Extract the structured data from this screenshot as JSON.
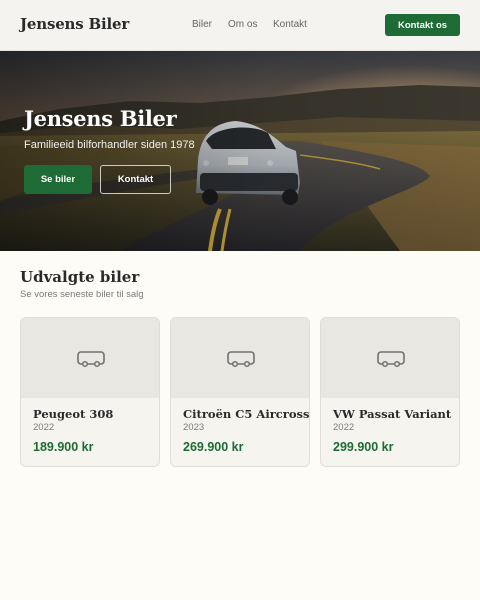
{
  "header": {
    "logo": "Jensens Biler",
    "nav": [
      "Biler",
      "Om os",
      "Kontakt"
    ],
    "cta_label": "Kontakt os"
  },
  "hero": {
    "title": "Jensens Biler",
    "subtitle": "Familieeid bilforhandler siden 1978",
    "primary_button": "Se biler",
    "secondary_button": "Kontakt"
  },
  "featured": {
    "title": "Udvalgte biler",
    "subtitle": "Se vores seneste biler til salg",
    "cars": [
      {
        "name": "Peugeot 308",
        "year": "2022",
        "price": "189.900 kr",
        "icon": "car-icon"
      },
      {
        "name": "Citroën C5 Aircross",
        "year": "2023",
        "price": "269.900 kr",
        "icon": "car-icon"
      },
      {
        "name": "VW Passat Variant",
        "year": "2022",
        "price": "299.900 kr",
        "icon": "car-icon"
      }
    ]
  },
  "colors": {
    "brand_green": "#1e6b35",
    "page_background": "#fdfcf7",
    "header_background": "#f4f3ef"
  }
}
